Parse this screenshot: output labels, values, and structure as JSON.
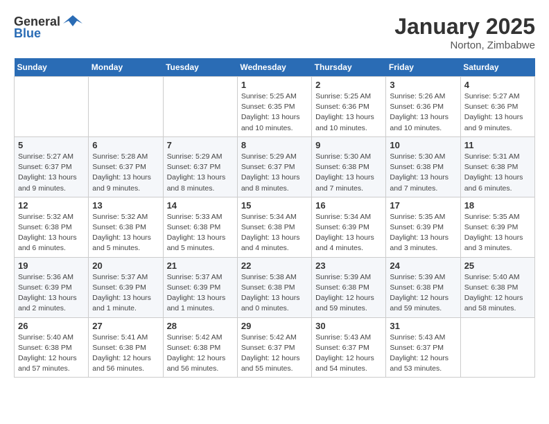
{
  "header": {
    "logo_general": "General",
    "logo_blue": "Blue",
    "month_title": "January 2025",
    "location": "Norton, Zimbabwe"
  },
  "days_of_week": [
    "Sunday",
    "Monday",
    "Tuesday",
    "Wednesday",
    "Thursday",
    "Friday",
    "Saturday"
  ],
  "weeks": [
    [
      {
        "day": "",
        "info": ""
      },
      {
        "day": "",
        "info": ""
      },
      {
        "day": "",
        "info": ""
      },
      {
        "day": "1",
        "info": "Sunrise: 5:25 AM\nSunset: 6:35 PM\nDaylight: 13 hours\nand 10 minutes."
      },
      {
        "day": "2",
        "info": "Sunrise: 5:25 AM\nSunset: 6:36 PM\nDaylight: 13 hours\nand 10 minutes."
      },
      {
        "day": "3",
        "info": "Sunrise: 5:26 AM\nSunset: 6:36 PM\nDaylight: 13 hours\nand 10 minutes."
      },
      {
        "day": "4",
        "info": "Sunrise: 5:27 AM\nSunset: 6:36 PM\nDaylight: 13 hours\nand 9 minutes."
      }
    ],
    [
      {
        "day": "5",
        "info": "Sunrise: 5:27 AM\nSunset: 6:37 PM\nDaylight: 13 hours\nand 9 minutes."
      },
      {
        "day": "6",
        "info": "Sunrise: 5:28 AM\nSunset: 6:37 PM\nDaylight: 13 hours\nand 9 minutes."
      },
      {
        "day": "7",
        "info": "Sunrise: 5:29 AM\nSunset: 6:37 PM\nDaylight: 13 hours\nand 8 minutes."
      },
      {
        "day": "8",
        "info": "Sunrise: 5:29 AM\nSunset: 6:37 PM\nDaylight: 13 hours\nand 8 minutes."
      },
      {
        "day": "9",
        "info": "Sunrise: 5:30 AM\nSunset: 6:38 PM\nDaylight: 13 hours\nand 7 minutes."
      },
      {
        "day": "10",
        "info": "Sunrise: 5:30 AM\nSunset: 6:38 PM\nDaylight: 13 hours\nand 7 minutes."
      },
      {
        "day": "11",
        "info": "Sunrise: 5:31 AM\nSunset: 6:38 PM\nDaylight: 13 hours\nand 6 minutes."
      }
    ],
    [
      {
        "day": "12",
        "info": "Sunrise: 5:32 AM\nSunset: 6:38 PM\nDaylight: 13 hours\nand 6 minutes."
      },
      {
        "day": "13",
        "info": "Sunrise: 5:32 AM\nSunset: 6:38 PM\nDaylight: 13 hours\nand 5 minutes."
      },
      {
        "day": "14",
        "info": "Sunrise: 5:33 AM\nSunset: 6:38 PM\nDaylight: 13 hours\nand 5 minutes."
      },
      {
        "day": "15",
        "info": "Sunrise: 5:34 AM\nSunset: 6:38 PM\nDaylight: 13 hours\nand 4 minutes."
      },
      {
        "day": "16",
        "info": "Sunrise: 5:34 AM\nSunset: 6:39 PM\nDaylight: 13 hours\nand 4 minutes."
      },
      {
        "day": "17",
        "info": "Sunrise: 5:35 AM\nSunset: 6:39 PM\nDaylight: 13 hours\nand 3 minutes."
      },
      {
        "day": "18",
        "info": "Sunrise: 5:35 AM\nSunset: 6:39 PM\nDaylight: 13 hours\nand 3 minutes."
      }
    ],
    [
      {
        "day": "19",
        "info": "Sunrise: 5:36 AM\nSunset: 6:39 PM\nDaylight: 13 hours\nand 2 minutes."
      },
      {
        "day": "20",
        "info": "Sunrise: 5:37 AM\nSunset: 6:39 PM\nDaylight: 13 hours\nand 1 minute."
      },
      {
        "day": "21",
        "info": "Sunrise: 5:37 AM\nSunset: 6:39 PM\nDaylight: 13 hours\nand 1 minutes."
      },
      {
        "day": "22",
        "info": "Sunrise: 5:38 AM\nSunset: 6:38 PM\nDaylight: 13 hours\nand 0 minutes."
      },
      {
        "day": "23",
        "info": "Sunrise: 5:39 AM\nSunset: 6:38 PM\nDaylight: 12 hours\nand 59 minutes."
      },
      {
        "day": "24",
        "info": "Sunrise: 5:39 AM\nSunset: 6:38 PM\nDaylight: 12 hours\nand 59 minutes."
      },
      {
        "day": "25",
        "info": "Sunrise: 5:40 AM\nSunset: 6:38 PM\nDaylight: 12 hours\nand 58 minutes."
      }
    ],
    [
      {
        "day": "26",
        "info": "Sunrise: 5:40 AM\nSunset: 6:38 PM\nDaylight: 12 hours\nand 57 minutes."
      },
      {
        "day": "27",
        "info": "Sunrise: 5:41 AM\nSunset: 6:38 PM\nDaylight: 12 hours\nand 56 minutes."
      },
      {
        "day": "28",
        "info": "Sunrise: 5:42 AM\nSunset: 6:38 PM\nDaylight: 12 hours\nand 56 minutes."
      },
      {
        "day": "29",
        "info": "Sunrise: 5:42 AM\nSunset: 6:37 PM\nDaylight: 12 hours\nand 55 minutes."
      },
      {
        "day": "30",
        "info": "Sunrise: 5:43 AM\nSunset: 6:37 PM\nDaylight: 12 hours\nand 54 minutes."
      },
      {
        "day": "31",
        "info": "Sunrise: 5:43 AM\nSunset: 6:37 PM\nDaylight: 12 hours\nand 53 minutes."
      },
      {
        "day": "",
        "info": ""
      }
    ]
  ]
}
